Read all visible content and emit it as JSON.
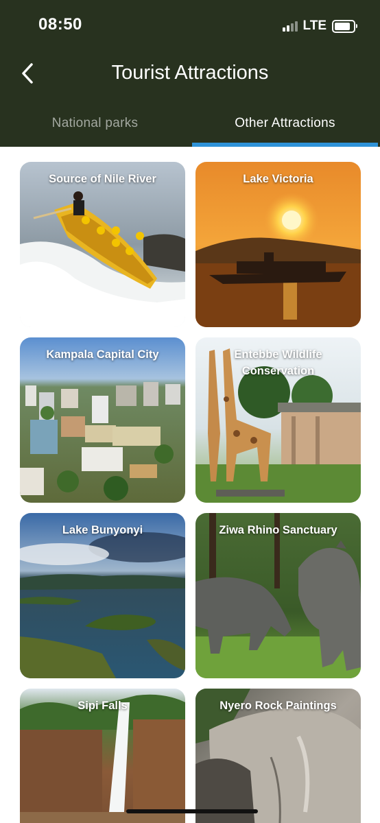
{
  "status_bar": {
    "time": "08:50",
    "network": "LTE",
    "signal_bars": 4,
    "signal_bars_active": 2,
    "battery_level": 0.85
  },
  "header": {
    "title": "Tourist Attractions",
    "back_icon": "chevron-left-icon"
  },
  "tabs": [
    {
      "label": "National parks",
      "active": false
    },
    {
      "label": "Other Attractions",
      "active": true
    }
  ],
  "colors": {
    "header_bg": "#28321f",
    "tab_indicator": "#2e92d8",
    "inactive_tab": "#a3a8a0"
  },
  "attractions": [
    {
      "title": "Source of Nile River"
    },
    {
      "title": "Lake Victoria"
    },
    {
      "title": "Kampala Capital City"
    },
    {
      "title": "Entebbe Wildlife Conservation"
    },
    {
      "title": "Lake Bunyonyi"
    },
    {
      "title": "Ziwa Rhino Sanctuary"
    },
    {
      "title": "Sipi Falls"
    },
    {
      "title": "Nyero Rock Paintings"
    }
  ]
}
